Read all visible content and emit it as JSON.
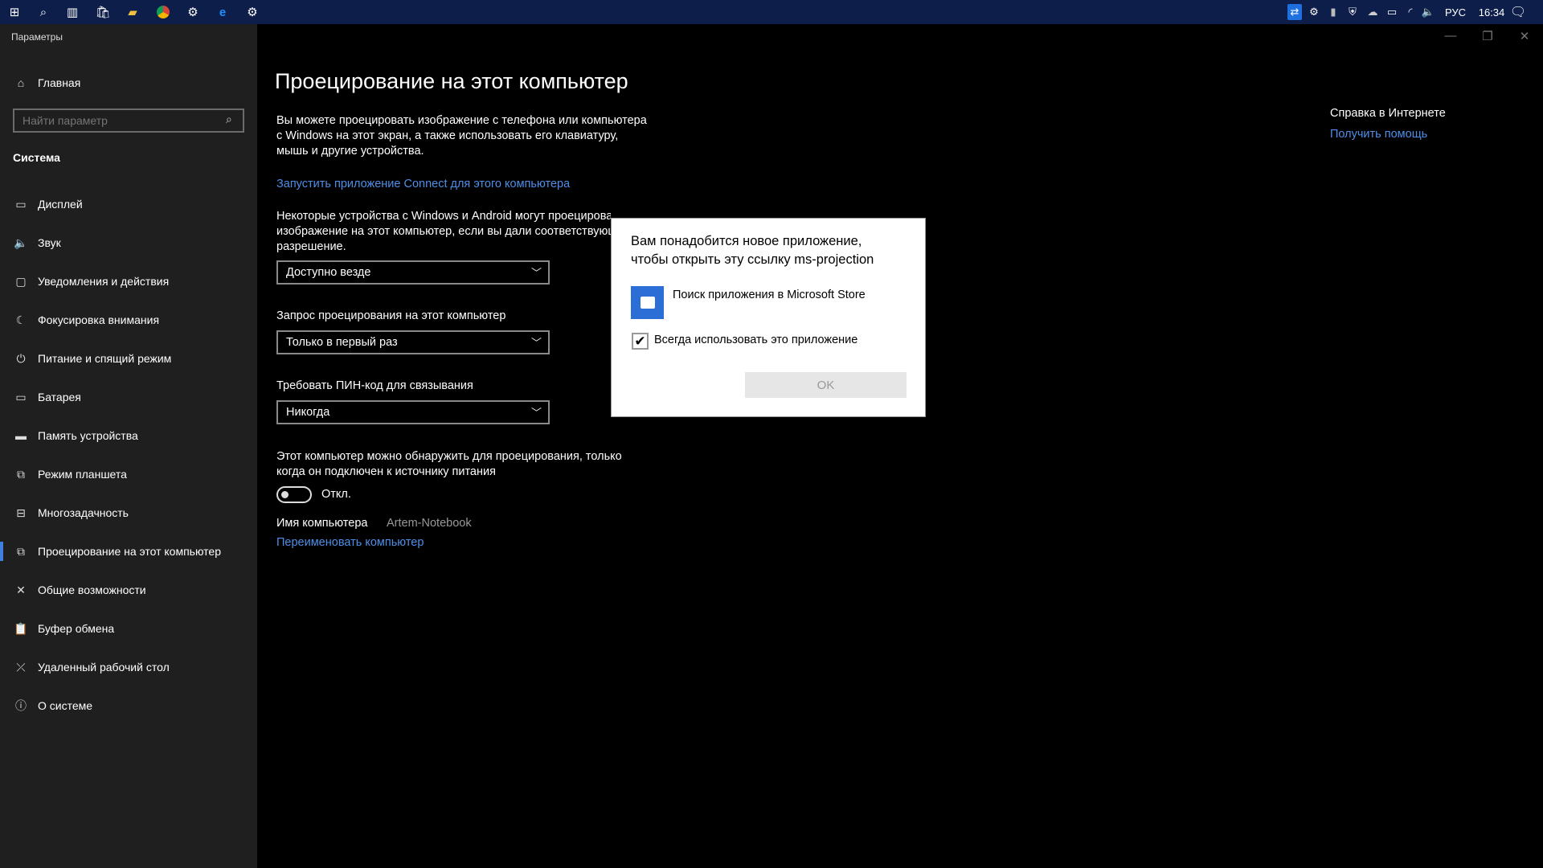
{
  "taskbar": {
    "icons": [
      "windows-start-icon",
      "search-icon",
      "task-view-icon",
      "store-icon",
      "file-explorer-icon",
      "chrome-icon",
      "steam-icon",
      "edge-icon",
      "settings-icon"
    ],
    "tray_icons": [
      "teamviewer-icon",
      "steam-icon",
      "usb-icon",
      "defender-icon",
      "onedrive-icon",
      "battery-icon",
      "wifi-icon",
      "volume-icon"
    ],
    "language": "РУС",
    "time": "16:34"
  },
  "window": {
    "title": "Параметры"
  },
  "sidebar": {
    "home": "Главная",
    "search_placeholder": "Найти параметр",
    "section": "Система",
    "items": [
      {
        "label": "Дисплей",
        "icon": "display-icon",
        "glyph": "▭"
      },
      {
        "label": "Звук",
        "icon": "sound-icon",
        "glyph": "🔈"
      },
      {
        "label": "Уведомления и действия",
        "icon": "notifications-icon",
        "glyph": "▢"
      },
      {
        "label": "Фокусировка внимания",
        "icon": "focus-moon-icon",
        "glyph": "☾"
      },
      {
        "label": "Питание и спящий режим",
        "icon": "power-icon",
        "glyph": "⏻"
      },
      {
        "label": "Батарея",
        "icon": "battery-icon",
        "glyph": "▭"
      },
      {
        "label": "Память устройства",
        "icon": "storage-icon",
        "glyph": "▬"
      },
      {
        "label": "Режим планшета",
        "icon": "tablet-icon",
        "glyph": "⧉"
      },
      {
        "label": "Многозадачность",
        "icon": "multitasking-icon",
        "glyph": "⊟"
      },
      {
        "label": "Проецирование на этот компьютер",
        "icon": "projecting-icon",
        "glyph": "⧉",
        "active": true
      },
      {
        "label": "Общие возможности",
        "icon": "shared-experiences-icon",
        "glyph": "✕"
      },
      {
        "label": "Буфер обмена",
        "icon": "clipboard-icon",
        "glyph": "📋"
      },
      {
        "label": "Удаленный рабочий стол",
        "icon": "remote-desktop-icon",
        "glyph": "⤫"
      },
      {
        "label": "О системе",
        "icon": "info-icon",
        "glyph": "ⓘ"
      }
    ]
  },
  "main": {
    "title": "Проецирование на этот компьютер",
    "desc": [
      "Вы можете проецировать изображение с телефона или компьютера",
      "с Windows на этот экран, а также использовать его клавиатуру,",
      "мышь и другие устройства."
    ],
    "connect_link": "Запустить приложение Connect для этого компьютера",
    "para": [
      "Некоторые устройства с Windows и Android могут проецировать",
      "изображение на этот компьютер, если вы дали соответствующее",
      "разрешение."
    ],
    "dropdown1": "Доступно везде",
    "label2": "Запрос проецирования на этот компьютер",
    "dropdown2": "Только в первый раз",
    "label3": "Требовать ПИН-код для связывания",
    "dropdown3": "Никогда",
    "discover": [
      "Этот компьютер можно обнаружить для проецирования, только",
      "когда он подключен к источнику питания"
    ],
    "toggle": {
      "state": "Откл.",
      "on": false
    },
    "pc_name_label": "Имя компьютера",
    "pc_name": "Artem-Notebook",
    "rename_link": "Переименовать компьютер"
  },
  "help": {
    "title": "Справка в Интернете",
    "link": "Получить помощь"
  },
  "dialog": {
    "title": [
      "Вам понадобится новое приложение,",
      "чтобы открыть эту ссылку ms-projection"
    ],
    "option": "Поиск приложения в Microsoft Store",
    "checkbox": "Всегда использовать это приложение",
    "checked": true,
    "ok": "OK"
  },
  "colors": {
    "accent": "#3f7fe0",
    "link": "#4d8fe8",
    "taskbar": "#0e1e4a",
    "sidebar": "#1f1f1f",
    "store_tile": "#2b6fd6"
  }
}
